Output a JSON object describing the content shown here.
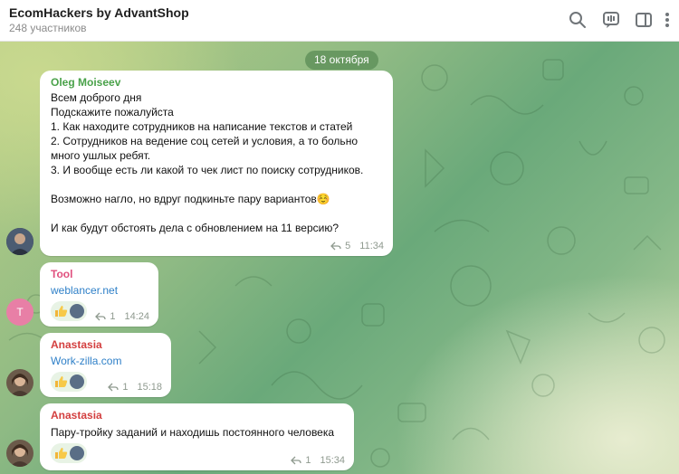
{
  "header": {
    "title": "EcomHackers by AdvantShop",
    "subtitle": "248 участников",
    "icons": [
      "search-icon",
      "live-chat-icon",
      "sidebar-toggle-icon",
      "more-vertical-icon"
    ]
  },
  "date_label": "18 октября",
  "messages": [
    {
      "sender": "Oleg Moiseev",
      "sender_color": "#4aa24a",
      "text": "Всем доброго дня\nПодскажите пожалуйста\n1. Как находите сотрудников на написание текстов и статей\n2. Сотрудников на ведение соц сетей и условия, а то больно\nмного  ушлых ребят.\n3. И вообще есть ли какой то чек лист по поиску сотрудников.\n\nВозможно нагло, но вдруг подкиньте пару вариантов☺️\n\nИ как будут обстоять дела с обновлением на 11 версию?",
      "replies": "5",
      "time": "11:34"
    },
    {
      "sender": "Tool",
      "sender_color": "#e0507e",
      "avatar_letter": "T",
      "text": "weblancer.net",
      "replies": "1",
      "time": "14:24"
    },
    {
      "sender": "Anastasia",
      "sender_color": "#d33f3f",
      "text": "Work-zilla.com",
      "replies": "1",
      "time": "15:18"
    },
    {
      "sender": "Anastasia",
      "sender_color": "#d33f3f",
      "text": "Пару-тройку заданий и находишь постоянного человека",
      "replies": "1",
      "time": "15:34"
    }
  ],
  "reaction_icon": "thumbs-up-icon"
}
